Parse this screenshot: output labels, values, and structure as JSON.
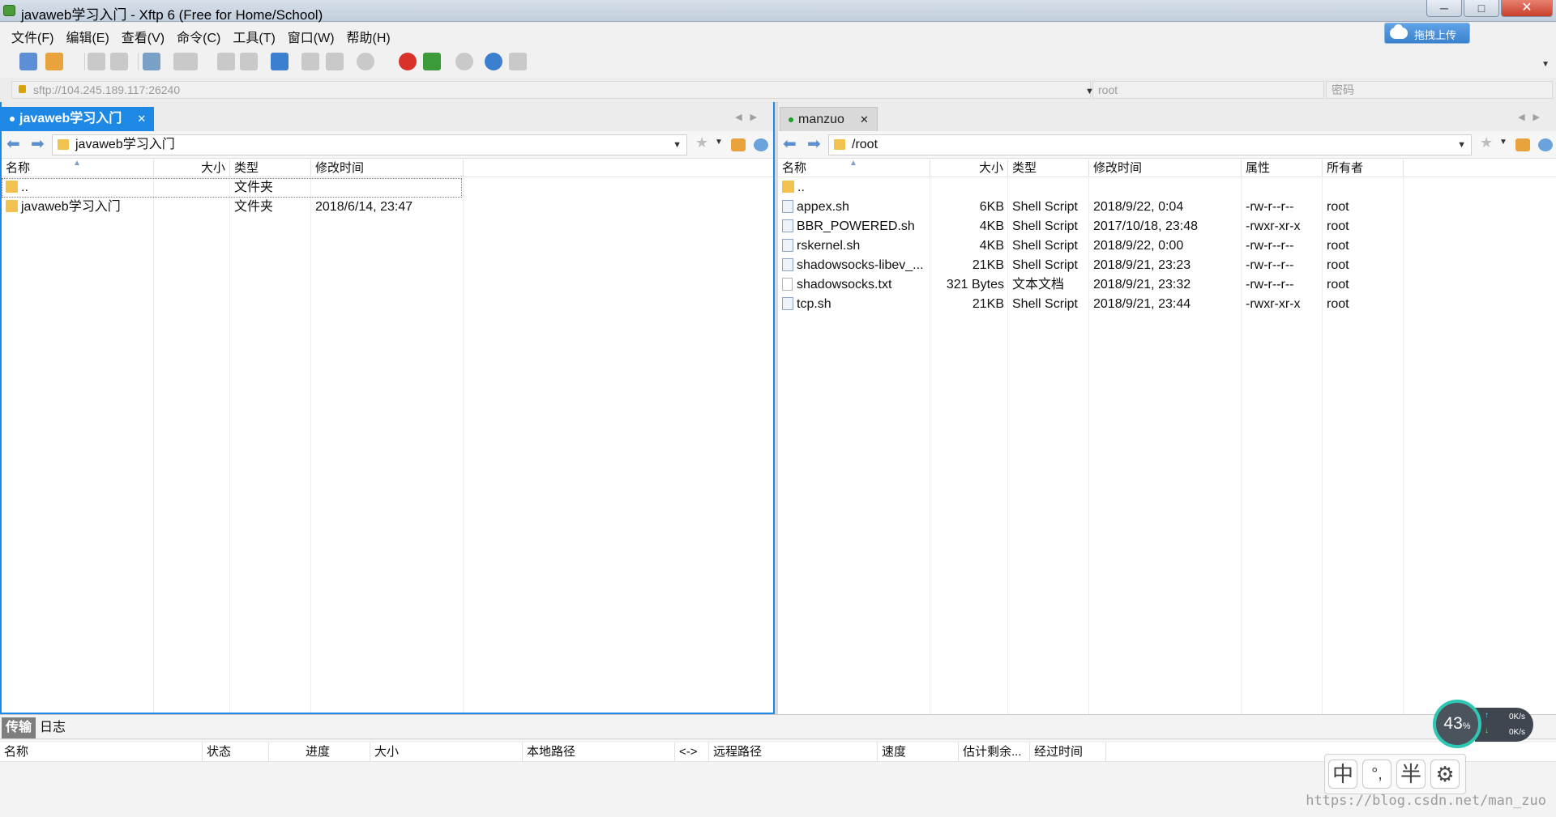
{
  "window": {
    "title": "javaweb学习入门 - Xftp 6 (Free for Home/School)",
    "min": "─",
    "max": "□",
    "close": "✕"
  },
  "menu": [
    "文件(F)",
    "编辑(E)",
    "查看(V)",
    "命令(C)",
    "工具(T)",
    "窗口(W)",
    "帮助(H)"
  ],
  "upload_button": "拖拽上传",
  "address": {
    "host": "sftp://104.245.189.117:26240",
    "username": "root",
    "password_placeholder": "密码"
  },
  "left_pane": {
    "tab_label": "javaweb学习入门",
    "path": "javaweb学习入门",
    "columns": [
      "名称",
      "大小",
      "类型",
      "修改时间"
    ],
    "rows": [
      {
        "name": "..",
        "size": "",
        "type": "文件夹",
        "modified": ""
      },
      {
        "name": "javaweb学习入门",
        "size": "",
        "type": "文件夹",
        "modified": "2018/6/14, 23:47"
      }
    ]
  },
  "right_pane": {
    "tab_label": "manzuo",
    "path": "/root",
    "columns": [
      "名称",
      "大小",
      "类型",
      "修改时间",
      "属性",
      "所有者"
    ],
    "rows": [
      {
        "name": "..",
        "size": "",
        "type": "",
        "modified": "",
        "attr": "",
        "owner": "",
        "icon": "folder"
      },
      {
        "name": "appex.sh",
        "size": "6KB",
        "type": "Shell Script",
        "modified": "2018/9/22, 0:04",
        "attr": "-rw-r--r--",
        "owner": "root",
        "icon": "script"
      },
      {
        "name": "BBR_POWERED.sh",
        "size": "4KB",
        "type": "Shell Script",
        "modified": "2017/10/18, 23:48",
        "attr": "-rwxr-xr-x",
        "owner": "root",
        "icon": "script"
      },
      {
        "name": "rskernel.sh",
        "size": "4KB",
        "type": "Shell Script",
        "modified": "2018/9/22, 0:00",
        "attr": "-rw-r--r--",
        "owner": "root",
        "icon": "script"
      },
      {
        "name": "shadowsocks-libev_...",
        "size": "21KB",
        "type": "Shell Script",
        "modified": "2018/9/21, 23:23",
        "attr": "-rw-r--r--",
        "owner": "root",
        "icon": "script"
      },
      {
        "name": "shadowsocks.txt",
        "size": "321 Bytes",
        "type": "文本文档",
        "modified": "2018/9/21, 23:32",
        "attr": "-rw-r--r--",
        "owner": "root",
        "icon": "text"
      },
      {
        "name": "tcp.sh",
        "size": "21KB",
        "type": "Shell Script",
        "modified": "2018/9/21, 23:44",
        "attr": "-rwxr-xr-x",
        "owner": "root",
        "icon": "script"
      }
    ]
  },
  "bottom": {
    "tabs": [
      "传输",
      "日志"
    ],
    "columns": [
      "名称",
      "状态",
      "进度",
      "大小",
      "本地路径",
      "<->",
      "远程路径",
      "速度",
      "估计剩余...",
      "经过时间"
    ]
  },
  "speed_widget": {
    "percent": "43",
    "percent_unit": "%",
    "up": "0K/s",
    "down": "0K/s"
  },
  "ime": [
    "中",
    "°,",
    "半",
    "⚙"
  ],
  "watermark": "https://blog.csdn.net/man_zuo",
  "colors": {
    "accent": "#1e88e5",
    "folder": "#f2c14e",
    "connected_dot": "#1aa32a"
  }
}
